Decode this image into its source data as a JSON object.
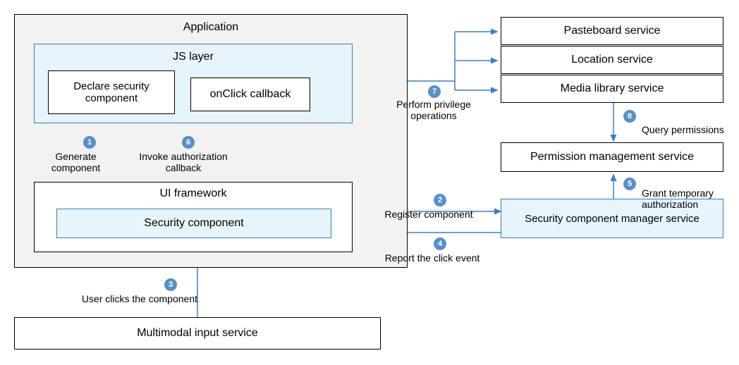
{
  "boxes": {
    "application": "Application",
    "js_layer": "JS layer",
    "declare_security": "Declare security component",
    "onclick_callback": "onClick callback",
    "ui_framework": "UI framework",
    "security_component": "Security component",
    "multimodal_input": "Multimodal input service",
    "pasteboard": "Pasteboard service",
    "location": "Location service",
    "media_library": "Media library service",
    "permission_mgmt": "Permission management service",
    "sec_comp_mgr": "Security component manager service"
  },
  "steps": {
    "s1": {
      "num": "1",
      "text": "Generate component"
    },
    "s2": {
      "num": "2",
      "text": "Register component"
    },
    "s3": {
      "num": "3",
      "text": "User clicks the component"
    },
    "s4": {
      "num": "4",
      "text": "Report the click event"
    },
    "s5": {
      "num": "5",
      "text": "Grant temporary authorization"
    },
    "s6": {
      "num": "6",
      "text": "Invoke authorization callback"
    },
    "s7": {
      "num": "7",
      "text": "Perform privilege operations"
    },
    "s8": {
      "num": "8",
      "text": "Query permissions"
    }
  },
  "colors": {
    "arrow_blue": "#3a7fc4",
    "badge_blue": "#5b8fc7",
    "box_blue_bg": "#e8f4fc",
    "box_blue_border": "#2a7fbf"
  }
}
